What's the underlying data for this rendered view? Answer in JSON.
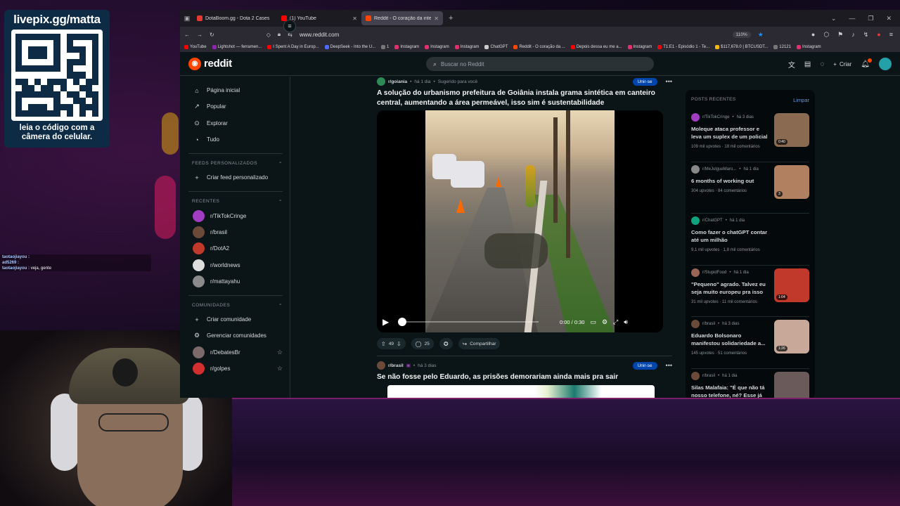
{
  "overlay": {
    "qr_url": "livepix.gg/matta",
    "qr_caption": "leia o código com a câmera do celular.",
    "chat": [
      {
        "user": "taotaojiayou :",
        "msg": ""
      },
      {
        "user": "ad5269 :",
        "msg": ""
      },
      {
        "user": "taotaojiayou :",
        "msg": "veja, gente"
      }
    ]
  },
  "browser": {
    "tabs": [
      {
        "title": "DotaBoom.gg - Dota 2 Cases",
        "color": "#e53935"
      },
      {
        "title": "(1) YouTube",
        "color": "#ff0000"
      },
      {
        "title": "Reddit - O coração da inte",
        "color": "#ff4500"
      }
    ],
    "url": "www.reddit.com",
    "zoom": "110%",
    "bookmarks": [
      {
        "label": "YouTube",
        "color": "#ff0000"
      },
      {
        "label": "Lightshot — ferramen...",
        "color": "#8e24aa"
      },
      {
        "label": "I Spent A Day in Europ...",
        "color": "#ff0000"
      },
      {
        "label": "DeepSeek - Into the U...",
        "color": "#4d6bfe"
      },
      {
        "label": "1",
        "color": "#777777"
      },
      {
        "label": "Instagram",
        "color": "#e1306c"
      },
      {
        "label": "Instagram",
        "color": "#e1306c"
      },
      {
        "label": "Instagram",
        "color": "#e1306c"
      },
      {
        "label": "ChatGPT",
        "color": "#cccccc"
      },
      {
        "label": "Reddit - O coração da ...",
        "color": "#ff4500"
      },
      {
        "label": "Depois dessa eu me a...",
        "color": "#ff0000"
      },
      {
        "label": "Instagram",
        "color": "#e1306c"
      },
      {
        "label": "T1:E1 - Episódio 1 - Te...",
        "color": "#e50914"
      },
      {
        "label": "$117,678.0 | BTCUSDT...",
        "color": "#f0b90b"
      },
      {
        "label": "12121",
        "color": "#777777"
      },
      {
        "label": "Instagram",
        "color": "#e1306c"
      }
    ]
  },
  "reddit": {
    "logo_text": "reddit",
    "search_placeholder": "Buscar no Reddit",
    "create_label": "Criar",
    "sidebar": {
      "nav": [
        {
          "label": "Página inicial",
          "icon": "home-icon",
          "glyph": "⌂"
        },
        {
          "label": "Popular",
          "icon": "popular-icon",
          "glyph": "↗"
        },
        {
          "label": "Explorar",
          "icon": "explore-icon",
          "glyph": "⊙"
        },
        {
          "label": "Tudo",
          "icon": "all-icon",
          "glyph": "◔"
        }
      ],
      "feeds_heading": "FEEDS PERSONALIZADOS",
      "create_feed": "Criar feed personalizado",
      "recent_heading": "RECENTES",
      "recent": [
        {
          "label": "r/TikTokCringe",
          "color": "#a23cc2"
        },
        {
          "label": "r/brasil",
          "color": "#6b4a3a"
        },
        {
          "label": "r/DotA2",
          "color": "#c0392b"
        },
        {
          "label": "r/worldnews",
          "color": "#dddddd"
        },
        {
          "label": "r/mattayahu",
          "color": "#8a8a8a"
        }
      ],
      "communities_heading": "COMUNIDADES",
      "create_community": "Criar comunidade",
      "manage_communities": "Gerenciar comunidades",
      "communities": [
        {
          "label": "r/DebatesBr",
          "color": "#7a6a6a"
        },
        {
          "label": "r/golpes",
          "color": "#d32f2f"
        }
      ]
    },
    "post1": {
      "subreddit": "r/goiania",
      "time": "há 1 dia",
      "suggested": "Sugerido para você",
      "join": "Unir-se",
      "title": "A solução do urbanismo prefeitura de Goiânia instala grama sintética em canteiro central, aumentando a área permeável, isso sim é sustentabilidade",
      "video_time": "0:00 / 0:30",
      "progress": 0,
      "votes": "49",
      "comments": "25",
      "share": "Compartilhar"
    },
    "post2": {
      "subreddit": "r/brasil",
      "time": "há 3 dias",
      "join": "Unir-se",
      "title": "Se não fosse pelo Eduardo, as prisões demorariam ainda mais pra sair"
    },
    "recent_posts": {
      "heading": "POSTS RECENTES",
      "clear": "Limpar",
      "items": [
        {
          "sub": "r/TikTokCringe",
          "time": "há 3 dias",
          "title": "Moleque ataca professor e leva um suplex de um policial",
          "stats": "109 mil upvotes · 18 mil comentários",
          "tag": "0:40",
          "thumb": "#8a6a50",
          "avatar": "#a23cc2"
        },
        {
          "sub": "r/MeJulgueMaro...",
          "time": "há 1 dia",
          "title": "6 months of working out",
          "stats": "304 upvotes · 84 comentários",
          "tag": "3",
          "thumb": "#b08060",
          "avatar": "#888888"
        },
        {
          "sub": "r/ChatGPT",
          "time": "há 1 dia",
          "title": "Como fazer o chatGPT contar até um milhão",
          "stats": "9,1 mil upvotes · 1,8 mil comentários",
          "tag": "",
          "thumb": "",
          "avatar": "#10a37f"
        },
        {
          "sub": "r/StupidFood",
          "time": "há 1 dia",
          "title": "\"Pequeno\" agrado. Talvez eu seja muito europeu pra isso",
          "stats": "31 mil upvotes · 11 mil comentários",
          "tag": "1:04",
          "thumb": "#c0392b",
          "avatar": "#996655"
        },
        {
          "sub": "r/brasil",
          "time": "há 3 dias",
          "title": "Eduardo Bolsonaro manifestou solidariedade a...",
          "stats": "145 upvotes · 51 comentários",
          "tag": "1:26",
          "thumb": "#c8a898",
          "avatar": "#6b4a3a"
        },
        {
          "sub": "r/brasil",
          "time": "há 1 dia",
          "title": "Silas Malafaia: \"É que não tá nosso telefone, né? Esse já",
          "stats": "",
          "tag": "",
          "thumb": "#6a5a5a",
          "avatar": "#6b4a3a"
        }
      ]
    }
  }
}
